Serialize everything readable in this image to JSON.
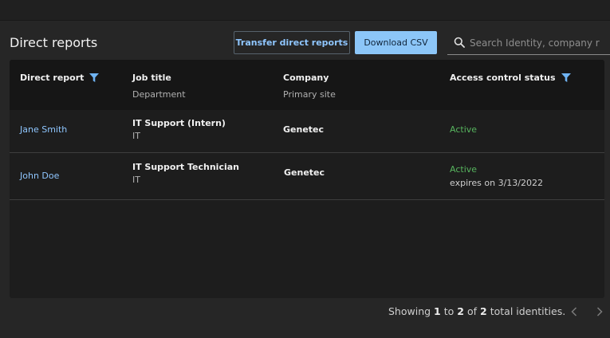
{
  "page": {
    "title": "Direct reports"
  },
  "toolbar": {
    "transfer_label": "Transfer direct reports",
    "download_label": "Download CSV",
    "search_placeholder": "Search Identity, company r"
  },
  "table": {
    "columns": [
      {
        "label": "Direct report",
        "sub": "",
        "filterable": true
      },
      {
        "label": "Job title",
        "sub": "Department",
        "filterable": false
      },
      {
        "label": "Company",
        "sub": "Primary site",
        "filterable": false
      },
      {
        "label": "Access control status",
        "sub": "",
        "filterable": true
      }
    ],
    "rows": [
      {
        "name": "Jane Smith",
        "job_title": "IT Support (Intern)",
        "department": "IT",
        "company": "Genetec",
        "status": "Active",
        "expires": ""
      },
      {
        "name": "John Doe",
        "job_title": "IT Support Technician",
        "department": "IT",
        "company": "Genetec",
        "status": "Active",
        "expires": "expires on 3/13/2022"
      }
    ]
  },
  "pagination": {
    "prefix": "Showing",
    "from": "1",
    "to_word": "to",
    "to": "2",
    "of_word": "of",
    "total": "2",
    "suffix": "total identities."
  },
  "colors": {
    "accent": "#8fc6ff",
    "primary_button": "#8cc6f8",
    "status_active": "#57b55e",
    "background": "#262626"
  },
  "icons": {
    "search": "search-icon",
    "filter": "filter-icon",
    "prev": "chevron-left-icon",
    "next": "chevron-right-icon"
  }
}
